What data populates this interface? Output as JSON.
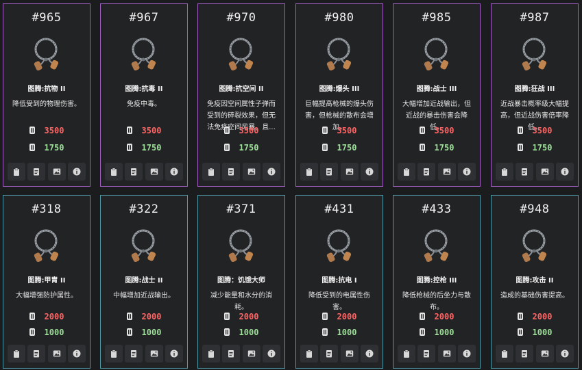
{
  "colors": {
    "row1_border": "#a25fc4",
    "row2_border": "#4f9aa6",
    "price_red": "#ff6464",
    "price_green": "#9ee09a"
  },
  "action_icons": [
    "clipboard-icon",
    "document-icon",
    "image-icon",
    "info-icon"
  ],
  "rows": [
    {
      "cards": [
        {
          "id": "#965",
          "name": "图腾:抗物 II",
          "desc": "降低受到的物理伤害。",
          "price_a": "3500",
          "price_b": "1750"
        },
        {
          "id": "#967",
          "name": "图腾:抗毒 II",
          "desc": "免疫中毒。",
          "price_a": "3500",
          "price_b": "1750"
        },
        {
          "id": "#970",
          "name": "图腾:抗空间 II",
          "desc": "免疫因空间属性子弹而受到的碎裂效果，但无法免疫空间风暴，且...",
          "price_a": "3500",
          "price_b": "1750"
        },
        {
          "id": "#980",
          "name": "图腾:爆头 III",
          "desc": "巨幅提高枪械的爆头伤害，但枪械的散布会增加。",
          "price_a": "3500",
          "price_b": "1750"
        },
        {
          "id": "#985",
          "name": "图腾:战士 III",
          "desc": "大幅增加近战输出，但近战的暴击伤害会降低。",
          "price_a": "3500",
          "price_b": "1750"
        },
        {
          "id": "#987",
          "name": "图腾:狂战 III",
          "desc": "近战暴击概率级大幅提高，但近战伤害倍率降低。",
          "price_a": "3500",
          "price_b": "1750"
        }
      ]
    },
    {
      "cards": [
        {
          "id": "#318",
          "name": "图腾:甲胄 II",
          "desc": "大幅增强防护属性。",
          "price_a": "2000",
          "price_b": "1000"
        },
        {
          "id": "#322",
          "name": "图腾:战士 II",
          "desc": "中幅增加近战输出。",
          "price_a": "2000",
          "price_b": "1000"
        },
        {
          "id": "#371",
          "name": "图腾：饥饿大师",
          "desc": "减少能量和水分的消耗。",
          "price_a": "2000",
          "price_b": "1000"
        },
        {
          "id": "#431",
          "name": "图腾:抗电 I",
          "desc": "降低受到的电属性伤害。",
          "price_a": "2000",
          "price_b": "1000"
        },
        {
          "id": "#433",
          "name": "图腾:控枪 III",
          "desc": "降低枪械的后坐力与散布。",
          "price_a": "2000",
          "price_b": "1000"
        },
        {
          "id": "#948",
          "name": "图腾:攻击 II",
          "desc": "造成的基础伤害提高。",
          "price_a": "2000",
          "price_b": "1000"
        }
      ]
    }
  ]
}
